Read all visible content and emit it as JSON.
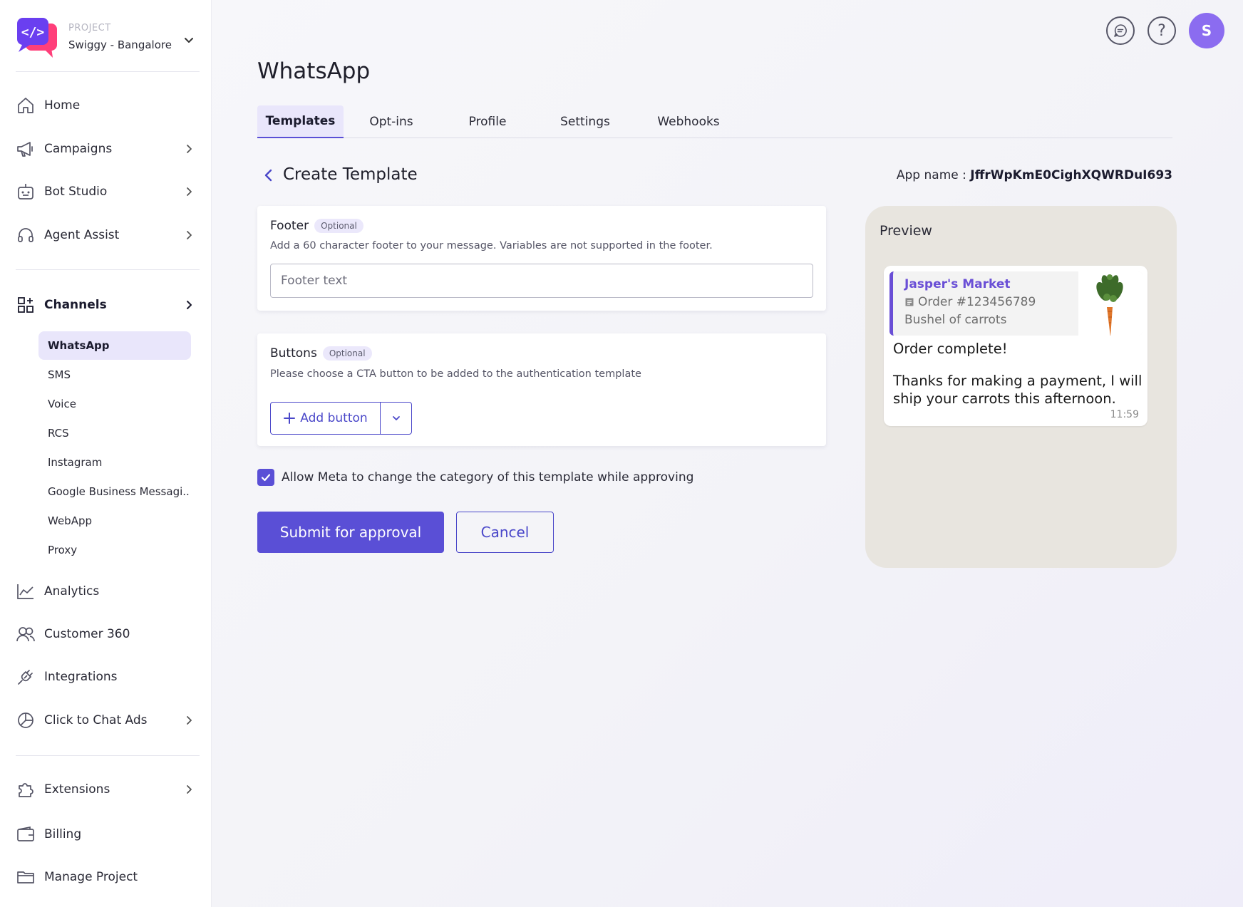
{
  "project": {
    "label": "PROJECT",
    "name": "Swiggy - Bangalore"
  },
  "nav": {
    "home": "Home",
    "campaigns": "Campaigns",
    "bot_studio": "Bot Studio",
    "agent_assist": "Agent Assist",
    "channels": "Channels",
    "analytics": "Analytics",
    "customer_360": "Customer 360",
    "integrations": "Integrations",
    "click_to_chat_ads": "Click to Chat Ads",
    "extensions": "Extensions",
    "billing": "Billing",
    "manage_project": "Manage Project"
  },
  "channels": {
    "items": [
      "WhatsApp",
      "SMS",
      "Voice",
      "RCS",
      "Instagram",
      "Google Business Messagi..",
      "WebApp",
      "Proxy"
    ],
    "active": "WhatsApp"
  },
  "header": {
    "avatar_initial": "S",
    "page_title": "WhatsApp"
  },
  "tabs": [
    "Templates",
    "Opt-ins",
    "Profile",
    "Settings",
    "Webhooks"
  ],
  "create": {
    "title": "Create Template",
    "app_name_label": "App name :",
    "app_name_value": "JffrWpKmE0CighXQWRDuI693"
  },
  "footer_card": {
    "title": "Footer",
    "badge": "Optional",
    "description": "Add a 60 character footer to your message. Variables are not supported in the footer.",
    "placeholder": "Footer text"
  },
  "buttons_card": {
    "title": "Buttons",
    "badge": "Optional",
    "description": "Please choose a CTA button to be added to the authentication template",
    "add_button": "Add button"
  },
  "allow_meta": {
    "checked": true,
    "label": "Allow Meta to change the category of this template while approving"
  },
  "actions": {
    "submit": "Submit for approval",
    "cancel": "Cancel"
  },
  "preview": {
    "title": "Preview",
    "quote_name": "Jasper's Market",
    "quote_order": "Order #123456789",
    "quote_item": "Bushel of carrots",
    "message_line1": "Order complete!",
    "message_line2": "Thanks for making a payment, I will",
    "message_line3": "ship your carrots this afternoon.",
    "time": "11:59"
  },
  "colors": {
    "accent": "#5a4fd6",
    "accent_light": "#e9e6fb",
    "avatar": "#8b6cf0",
    "preview_bg": "#e8e5df"
  }
}
